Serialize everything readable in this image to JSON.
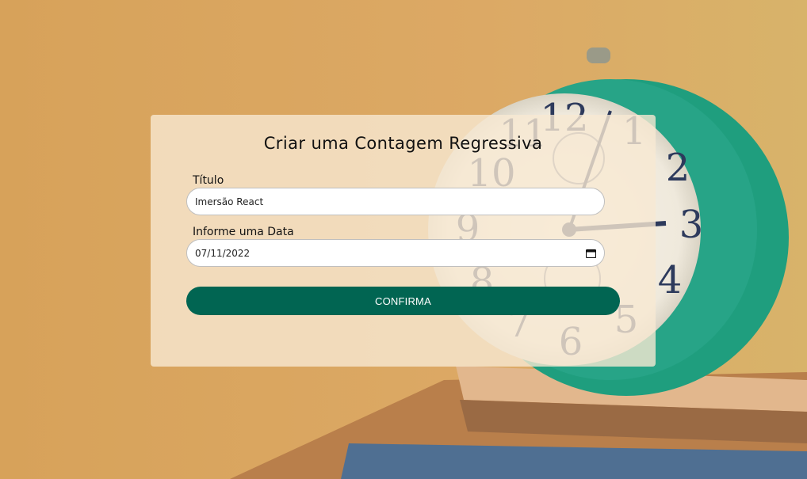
{
  "form": {
    "heading": "Criar uma Contagem Regressiva",
    "title_label": "Título",
    "title_value": "Imersão React",
    "date_label": "Informe uma Data",
    "date_value": "07/11/2022",
    "submit_label": "CONFIRMA"
  },
  "colors": {
    "background": "#d9a85e",
    "button": "#016552",
    "clock_body": "#1f9e7e"
  },
  "icons": [
    "calendar-icon"
  ]
}
